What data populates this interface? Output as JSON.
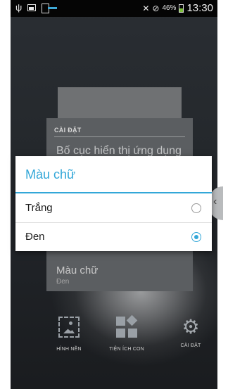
{
  "status_bar": {
    "battery_percent": "46%",
    "time": "13:30",
    "icons": [
      "usb-icon",
      "image-notification-icon",
      "download-icon",
      "silent-icon",
      "blocked-icon",
      "battery-icon"
    ]
  },
  "settings_panel": {
    "header": "CÀI ĐẶT",
    "item1": "Bố cục hiển thị ứng dụng",
    "item2_title": "Màu chữ",
    "item2_value": "Đen"
  },
  "dialog": {
    "title": "Màu chữ",
    "options": [
      {
        "label": "Trắng",
        "checked": false
      },
      {
        "label": "Đen",
        "checked": true
      }
    ]
  },
  "dock": {
    "items": [
      {
        "label": "HÌNH NỀN",
        "icon": "wallpaper-icon"
      },
      {
        "label": "TIỆN ÍCH CON",
        "icon": "widgets-icon"
      },
      {
        "label": "CÀI ĐẶT",
        "icon": "gear-icon"
      }
    ]
  },
  "colors": {
    "accent": "#33a7d8",
    "panel": "#5b5e61"
  }
}
